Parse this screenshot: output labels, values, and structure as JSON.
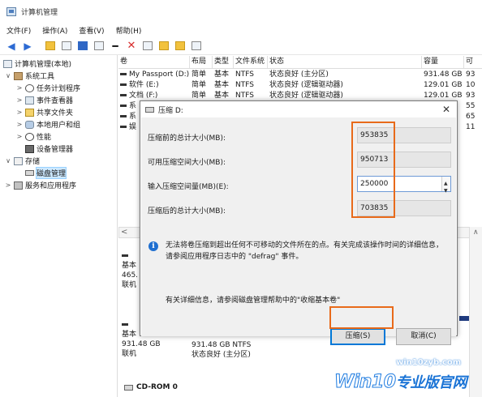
{
  "app": {
    "title": "计算机管理"
  },
  "menu": [
    "文件(F)",
    "操作(A)",
    "查看(V)",
    "帮助(H)"
  ],
  "tree": [
    {
      "label": "计算机管理(本地)",
      "icon": "computer-management-icon"
    },
    {
      "label": "系统工具",
      "icon": "system-tools-icon"
    },
    {
      "label": "任务计划程序",
      "icon": "task-scheduler-icon"
    },
    {
      "label": "事件查看器",
      "icon": "event-viewer-icon"
    },
    {
      "label": "共享文件夹",
      "icon": "shared-folder-icon"
    },
    {
      "label": "本地用户和组",
      "icon": "users-icon"
    },
    {
      "label": "性能",
      "icon": "performance-icon"
    },
    {
      "label": "设备管理器",
      "icon": "device-manager-icon"
    },
    {
      "label": "存储",
      "icon": "storage-icon"
    },
    {
      "label": "磁盘管理",
      "icon": "disk-icon"
    },
    {
      "label": "服务和应用程序",
      "icon": "services-icon"
    }
  ],
  "columns": [
    "卷",
    "布局",
    "类型",
    "文件系统",
    "状态",
    "容量",
    "可"
  ],
  "volumes": [
    {
      "name": "My Passport (D:)",
      "layout": "简单",
      "type": "基本",
      "fs": "NTFS",
      "status": "状态良好 (主分区)",
      "capacity": "931.48 GB",
      "free": "93"
    },
    {
      "name": "软件 (E:)",
      "layout": "简单",
      "type": "基本",
      "fs": "NTFS",
      "status": "状态良好 (逻辑驱动器)",
      "capacity": "129.01 GB",
      "free": "10"
    },
    {
      "name": "文档 (F:)",
      "layout": "简单",
      "type": "基本",
      "fs": "NTFS",
      "status": "状态良好 (逻辑驱动器)",
      "capacity": "129.01 GB",
      "free": "93"
    },
    {
      "name": "系",
      "layout": "",
      "type": "",
      "fs": "",
      "status": "",
      "capacity": "",
      "free": "55"
    },
    {
      "name": "系",
      "layout": "",
      "type": "",
      "fs": "",
      "status": "",
      "capacity": "",
      "free": "65"
    },
    {
      "name": "娱",
      "layout": "",
      "type": "",
      "fs": "",
      "status": "",
      "capacity": "",
      "free": "11"
    }
  ],
  "disk_top": {
    "l1": "基本",
    "l2": "465.",
    "l3": "联机"
  },
  "disk_bottom": {
    "l1": "基本",
    "l2": "931.48 GB",
    "l3": "联机",
    "part_size": "931.48 GB NTFS",
    "part_status": "状态良好 (主分区)"
  },
  "cdrom_label": "CD-ROM 0",
  "dialog": {
    "title": "压缩 D:",
    "fields": [
      {
        "label": "压缩前的总计大小(MB):",
        "value": "953835"
      },
      {
        "label": "可用压缩空间大小(MB):",
        "value": "950713"
      },
      {
        "label": "输入压缩空间量(MB)(E):",
        "value": "250000"
      },
      {
        "label": "压缩后的总计大小(MB):",
        "value": "703835"
      }
    ],
    "info": "无法将卷压缩到超出任何不可移动的文件所在的点。有关完成该操作时间的详细信息，请参阅应用程序日志中的 \"defrag\" 事件。",
    "help": "有关详细信息，请参阅磁盘管理帮助中的\"收缩基本卷\"",
    "compress_button": "压缩(S)",
    "cancel_button": "取消(C)"
  },
  "watermark": {
    "url": "win10zyb.com",
    "brand": "Win10",
    "brand_cn": "专业版官网"
  },
  "colors": {
    "highlight": "#e86a1a",
    "accent": "#0078d7",
    "partition_bar": "#1e3a7e"
  }
}
